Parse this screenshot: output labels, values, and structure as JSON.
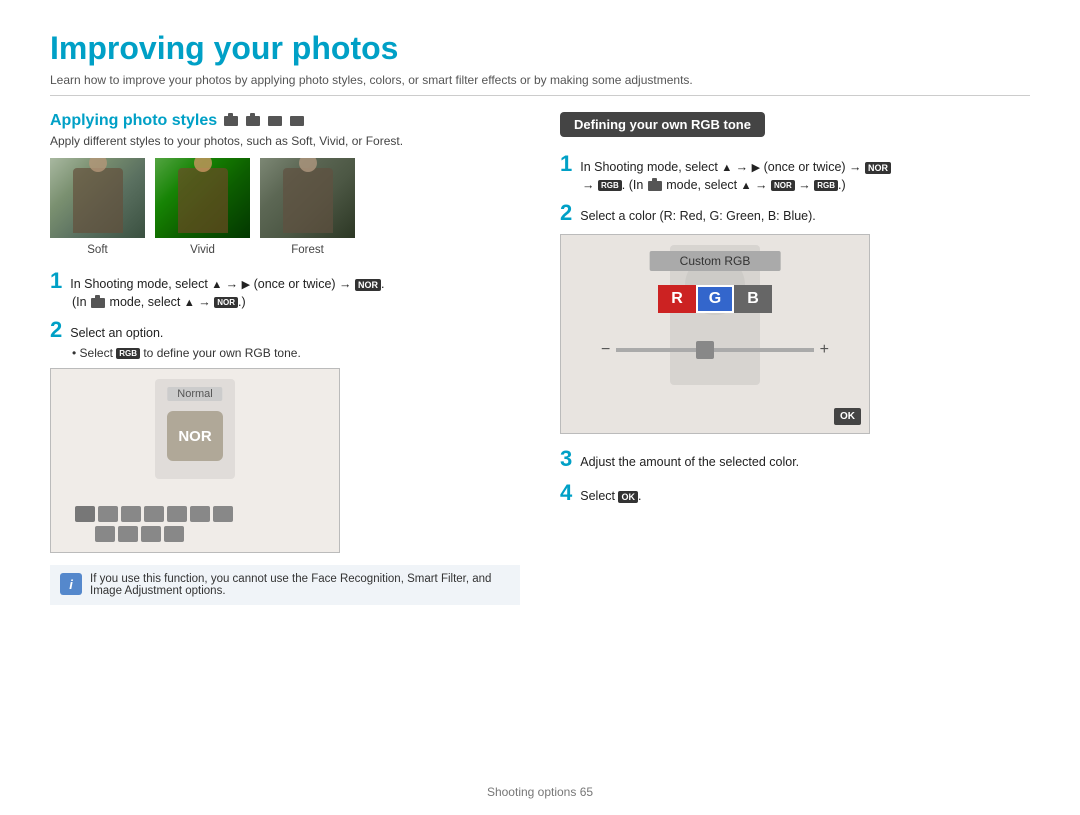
{
  "page": {
    "title": "Improving your photos",
    "subtitle": "Learn how to improve your photos by applying photo styles, colors, or smart filter effects or by making some adjustments.",
    "footer": "Shooting options  65"
  },
  "left": {
    "section_title": "Applying photo styles",
    "section_desc": "Apply different styles to your photos, such as Soft, Vivid, or Forest.",
    "photo_labels": [
      "Soft",
      "Vivid",
      "Forest"
    ],
    "step1_text": "In Shooting mode, select",
    "step1_suffix": "(once or twice) →",
    "step1_sub": "(In    mode, select    →    .)",
    "step2_text": "Select an option.",
    "bullet": "Select    to define your own RGB tone.",
    "note_text": "If you use this function, you cannot use the Face Recognition, Smart Filter, and Image Adjustment options."
  },
  "right": {
    "header": "Defining your own RGB tone",
    "step1_text": "In Shooting mode, select",
    "step1_suffix": "(once or twice) →",
    "step1_sub": "→    . (In    mode, select    →    →    .)",
    "step2_text": "Select a color (R: Red, G: Green, B: Blue).",
    "rgb_title": "Custom RGB",
    "rgb_r": "R",
    "rgb_g": "G",
    "rgb_b": "B",
    "step3_text": "Adjust the amount of the selected color.",
    "step4_text": "Select",
    "step4_ok": "OK"
  },
  "ui": {
    "normal_label": "Normal",
    "nor_label": "NOR"
  }
}
